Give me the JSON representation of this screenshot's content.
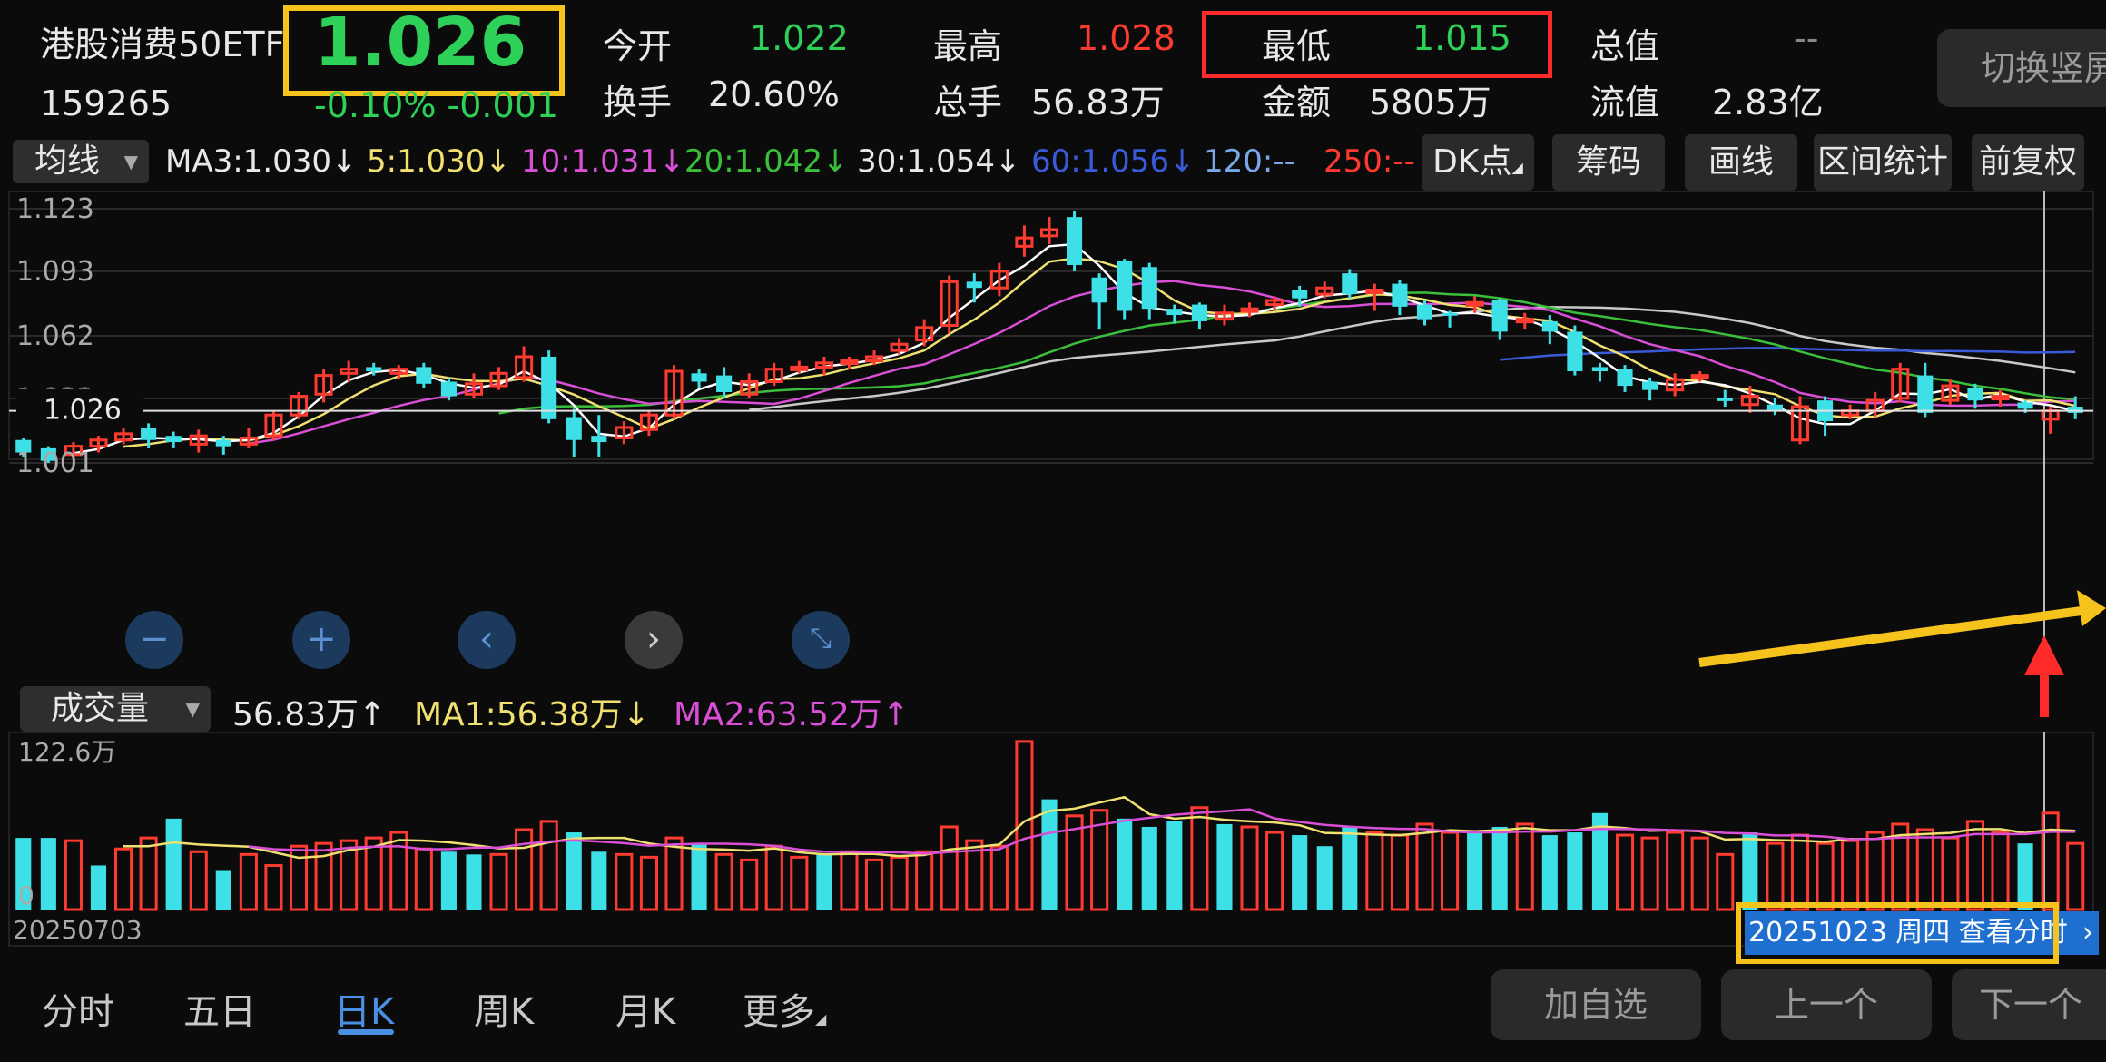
{
  "header": {
    "name": "港股消费50ETF",
    "code": "159265",
    "price": "1.026",
    "change": "-0.10% -0.001",
    "open_label": "今开",
    "open_value": "1.022",
    "turnover_label": "换手",
    "turnover_value": "20.60%",
    "high_label": "最高",
    "high_value": "1.028",
    "volume_label": "总手",
    "volume_value": "56.83万",
    "low_label": "最低",
    "low_value": "1.015",
    "amount_label": "金额",
    "amount_value": "5805万",
    "mcap_label": "总值",
    "mcap_value": "--",
    "float_label": "流值",
    "float_value": "2.83亿",
    "switch_label": "切换竖屏"
  },
  "toolbar": {
    "ma_select": "均线",
    "ma3": "MA3:1.030↓",
    "ma5": "5:1.030↓",
    "ma10": "10:1.031↓",
    "ma20": "20:1.042↓",
    "ma30": "30:1.054↓",
    "ma60": "60:1.056↓",
    "ma120": "120:--",
    "ma250": "250:--",
    "dk": "DK点",
    "chips": "筹码",
    "draw": "画线",
    "range_stats": "区间统计",
    "adjust": "前复权"
  },
  "volume_bar": {
    "select": "成交量",
    "value": "56.83万↑",
    "ma1": "MA1:56.38万↓",
    "ma2": "MA2:63.52万↑"
  },
  "date_button": "20251023 周四 查看分时",
  "tabs": [
    "分时",
    "五日",
    "日K",
    "周K",
    "月K",
    "更多"
  ],
  "buttons": {
    "add": "加自选",
    "prev": "上一个",
    "next": "下一个"
  },
  "colors": {
    "up": "#ff3b30",
    "down": "#3ee0e8",
    "accent": "#f6c21c",
    "active": "#4a90e2"
  },
  "chart_data": {
    "type": "candlestick",
    "ylim": [
      1.001,
      1.123
    ],
    "y_ticks": [
      "1.123",
      "1.093",
      "1.062",
      "1.032",
      "1.001"
    ],
    "current_price_label": "1.026",
    "volume_max_label": "122.6万",
    "volume_zero_label": "0",
    "start_date_label": "20250703",
    "candles": [
      [
        1.012,
        1.006,
        1.013,
        1.004,
        "d"
      ],
      [
        1.008,
        1.002,
        1.009,
        1.001,
        "d"
      ],
      [
        1.005,
        1.009,
        1.011,
        1.003,
        "u"
      ],
      [
        1.009,
        1.012,
        1.014,
        1.006,
        "u"
      ],
      [
        1.012,
        1.015,
        1.018,
        1.01,
        "u"
      ],
      [
        1.018,
        1.012,
        1.02,
        1.008,
        "d"
      ],
      [
        1.014,
        1.011,
        1.016,
        1.008,
        "d"
      ],
      [
        1.01,
        1.014,
        1.017,
        1.006,
        "u"
      ],
      [
        1.012,
        1.009,
        1.014,
        1.005,
        "d"
      ],
      [
        1.01,
        1.013,
        1.018,
        1.008,
        "u"
      ],
      [
        1.014,
        1.024,
        1.026,
        1.012,
        "u"
      ],
      [
        1.024,
        1.033,
        1.035,
        1.022,
        "u"
      ],
      [
        1.034,
        1.043,
        1.046,
        1.03,
        "u"
      ],
      [
        1.044,
        1.046,
        1.05,
        1.04,
        "u"
      ],
      [
        1.047,
        1.045,
        1.049,
        1.043,
        "d"
      ],
      [
        1.044,
        1.046,
        1.048,
        1.041,
        "u"
      ],
      [
        1.047,
        1.039,
        1.049,
        1.037,
        "d"
      ],
      [
        1.04,
        1.033,
        1.042,
        1.031,
        "d"
      ],
      [
        1.034,
        1.039,
        1.044,
        1.032,
        "u"
      ],
      [
        1.038,
        1.044,
        1.047,
        1.036,
        "u"
      ],
      [
        1.042,
        1.052,
        1.057,
        1.04,
        "u"
      ],
      [
        1.052,
        1.022,
        1.055,
        1.02,
        "d"
      ],
      [
        1.023,
        1.012,
        1.027,
        1.004,
        "d"
      ],
      [
        1.014,
        1.011,
        1.024,
        1.004,
        "d"
      ],
      [
        1.013,
        1.018,
        1.021,
        1.01,
        "u"
      ],
      [
        1.017,
        1.024,
        1.026,
        1.014,
        "u"
      ],
      [
        1.024,
        1.045,
        1.048,
        1.022,
        "u"
      ],
      [
        1.044,
        1.04,
        1.046,
        1.037,
        "d"
      ],
      [
        1.043,
        1.035,
        1.047,
        1.032,
        "d"
      ],
      [
        1.034,
        1.04,
        1.044,
        1.032,
        "u"
      ],
      [
        1.04,
        1.046,
        1.049,
        1.038,
        "u"
      ],
      [
        1.046,
        1.047,
        1.05,
        1.044,
        "u"
      ],
      [
        1.047,
        1.049,
        1.052,
        1.043,
        "u"
      ],
      [
        1.049,
        1.05,
        1.052,
        1.046,
        "u"
      ],
      [
        1.05,
        1.052,
        1.055,
        1.048,
        "u"
      ],
      [
        1.055,
        1.058,
        1.061,
        1.053,
        "u"
      ],
      [
        1.06,
        1.066,
        1.07,
        1.057,
        "u"
      ],
      [
        1.067,
        1.088,
        1.091,
        1.063,
        "u"
      ],
      [
        1.088,
        1.085,
        1.092,
        1.078,
        "d"
      ],
      [
        1.085,
        1.093,
        1.097,
        1.081,
        "u"
      ],
      [
        1.105,
        1.109,
        1.115,
        1.1,
        "u"
      ],
      [
        1.11,
        1.113,
        1.119,
        1.106,
        "u"
      ],
      [
        1.119,
        1.096,
        1.122,
        1.093,
        "d"
      ],
      [
        1.09,
        1.078,
        1.092,
        1.065,
        "d"
      ],
      [
        1.098,
        1.074,
        1.099,
        1.07,
        "d"
      ],
      [
        1.095,
        1.075,
        1.097,
        1.07,
        "d"
      ],
      [
        1.075,
        1.072,
        1.077,
        1.068,
        "d"
      ],
      [
        1.077,
        1.069,
        1.078,
        1.065,
        "d"
      ],
      [
        1.07,
        1.073,
        1.077,
        1.067,
        "u"
      ],
      [
        1.075,
        1.074,
        1.078,
        1.071,
        "u"
      ],
      [
        1.077,
        1.079,
        1.081,
        1.074,
        "u"
      ],
      [
        1.084,
        1.08,
        1.086,
        1.076,
        "d"
      ],
      [
        1.082,
        1.085,
        1.088,
        1.08,
        "u"
      ],
      [
        1.092,
        1.082,
        1.094,
        1.08,
        "d"
      ],
      [
        1.083,
        1.084,
        1.087,
        1.074,
        "u"
      ],
      [
        1.087,
        1.076,
        1.089,
        1.072,
        "d"
      ],
      [
        1.077,
        1.07,
        1.079,
        1.067,
        "d"
      ],
      [
        1.073,
        1.072,
        1.074,
        1.066,
        "d"
      ],
      [
        1.078,
        1.077,
        1.081,
        1.073,
        "u"
      ],
      [
        1.079,
        1.064,
        1.08,
        1.06,
        "d"
      ],
      [
        1.07,
        1.069,
        1.073,
        1.065,
        "u"
      ],
      [
        1.069,
        1.064,
        1.072,
        1.058,
        "d"
      ],
      [
        1.064,
        1.045,
        1.067,
        1.043,
        "d"
      ],
      [
        1.047,
        1.045,
        1.049,
        1.04,
        "d"
      ],
      [
        1.046,
        1.038,
        1.048,
        1.035,
        "d"
      ],
      [
        1.04,
        1.036,
        1.042,
        1.031,
        "d"
      ],
      [
        1.036,
        1.041,
        1.044,
        1.033,
        "u"
      ],
      [
        1.042,
        1.043,
        1.045,
        1.04,
        "u"
      ],
      [
        1.032,
        1.031,
        1.036,
        1.028,
        "d"
      ],
      [
        1.033,
        1.029,
        1.038,
        1.025,
        "u"
      ],
      [
        1.029,
        1.026,
        1.032,
        1.024,
        "d"
      ],
      [
        1.028,
        1.012,
        1.033,
        1.01,
        "u"
      ],
      [
        1.031,
        1.021,
        1.033,
        1.014,
        "d"
      ],
      [
        1.024,
        1.026,
        1.029,
        1.022,
        "u"
      ],
      [
        1.026,
        1.031,
        1.035,
        1.023,
        "u"
      ],
      [
        1.032,
        1.046,
        1.049,
        1.03,
        "u"
      ],
      [
        1.043,
        1.025,
        1.049,
        1.023,
        "d"
      ],
      [
        1.031,
        1.038,
        1.041,
        1.029,
        "u"
      ],
      [
        1.037,
        1.031,
        1.039,
        1.027,
        "d"
      ],
      [
        1.032,
        1.033,
        1.036,
        1.028,
        "u"
      ],
      [
        1.03,
        1.027,
        1.031,
        1.025,
        "d"
      ],
      [
        1.022,
        1.026,
        1.028,
        1.015,
        "u"
      ],
      [
        1.028,
        1.025,
        1.033,
        1.022,
        "d"
      ]
    ],
    "volumes": [
      [
        52,
        "d"
      ],
      [
        52,
        "d"
      ],
      [
        50,
        "u"
      ],
      [
        32,
        "d"
      ],
      [
        44,
        "u"
      ],
      [
        52,
        "u"
      ],
      [
        66,
        "d"
      ],
      [
        42,
        "u"
      ],
      [
        28,
        "d"
      ],
      [
        40,
        "u"
      ],
      [
        32,
        "u"
      ],
      [
        46,
        "u"
      ],
      [
        48,
        "u"
      ],
      [
        50,
        "u"
      ],
      [
        52,
        "u"
      ],
      [
        56,
        "u"
      ],
      [
        44,
        "u"
      ],
      [
        42,
        "d"
      ],
      [
        40,
        "d"
      ],
      [
        40,
        "u"
      ],
      [
        58,
        "u"
      ],
      [
        64,
        "u"
      ],
      [
        56,
        "d"
      ],
      [
        42,
        "d"
      ],
      [
        40,
        "u"
      ],
      [
        38,
        "u"
      ],
      [
        52,
        "u"
      ],
      [
        48,
        "d"
      ],
      [
        40,
        "u"
      ],
      [
        36,
        "u"
      ],
      [
        46,
        "u"
      ],
      [
        38,
        "u"
      ],
      [
        40,
        "d"
      ],
      [
        42,
        "u"
      ],
      [
        36,
        "u"
      ],
      [
        38,
        "u"
      ],
      [
        42,
        "u"
      ],
      [
        60,
        "u"
      ],
      [
        50,
        "u"
      ],
      [
        46,
        "u"
      ],
      [
        122,
        "u"
      ],
      [
        80,
        "d"
      ],
      [
        68,
        "u"
      ],
      [
        72,
        "u"
      ],
      [
        66,
        "d"
      ],
      [
        60,
        "d"
      ],
      [
        64,
        "d"
      ],
      [
        74,
        "u"
      ],
      [
        62,
        "d"
      ],
      [
        60,
        "u"
      ],
      [
        56,
        "u"
      ],
      [
        54,
        "d"
      ],
      [
        46,
        "d"
      ],
      [
        60,
        "d"
      ],
      [
        56,
        "u"
      ],
      [
        54,
        "u"
      ],
      [
        62,
        "u"
      ],
      [
        56,
        "u"
      ],
      [
        56,
        "d"
      ],
      [
        60,
        "d"
      ],
      [
        62,
        "u"
      ],
      [
        54,
        "d"
      ],
      [
        56,
        "d"
      ],
      [
        70,
        "d"
      ],
      [
        54,
        "u"
      ],
      [
        52,
        "u"
      ],
      [
        56,
        "u"
      ],
      [
        52,
        "u"
      ],
      [
        40,
        "u"
      ],
      [
        56,
        "d"
      ],
      [
        48,
        "u"
      ],
      [
        54,
        "u"
      ],
      [
        48,
        "u"
      ],
      [
        50,
        "u"
      ],
      [
        56,
        "u"
      ],
      [
        62,
        "u"
      ],
      [
        58,
        "u"
      ],
      [
        52,
        "u"
      ],
      [
        64,
        "u"
      ],
      [
        56,
        "u"
      ],
      [
        48,
        "d"
      ],
      [
        70,
        "u"
      ],
      [
        48,
        "u"
      ]
    ],
    "ma_colors": {
      "ma3": "#ffffff",
      "ma5": "#f0e070",
      "ma10": "#d94fd6",
      "ma20": "#3bbf3b",
      "ma30": "#c8c8c8",
      "ma60": "#3a5ad8"
    }
  }
}
